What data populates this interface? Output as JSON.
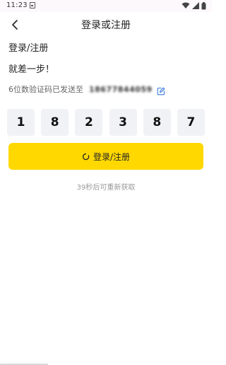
{
  "status_bar": {
    "time": "11:23",
    "icons": [
      "notification-icon",
      "wifi-icon",
      "signal-icon",
      "battery-icon"
    ]
  },
  "nav": {
    "title": "登录或注册",
    "back_icon": "chevron-left-icon"
  },
  "form": {
    "title": "登录/注册",
    "subtitle": "就差一步！",
    "sent_text": "6位数验证码已发送至",
    "phone_masked": "18677844059",
    "edit_icon": "edit-icon",
    "code_digits": [
      "1",
      "8",
      "2",
      "3",
      "8",
      "7"
    ],
    "submit_label": "登录/注册",
    "resend_text": "39秒后可重新获取"
  },
  "colors": {
    "accent": "#ffd800",
    "code_box_bg": "#f1f2f6",
    "edit_icon": "#3b7bd9",
    "muted_text": "#999999"
  }
}
